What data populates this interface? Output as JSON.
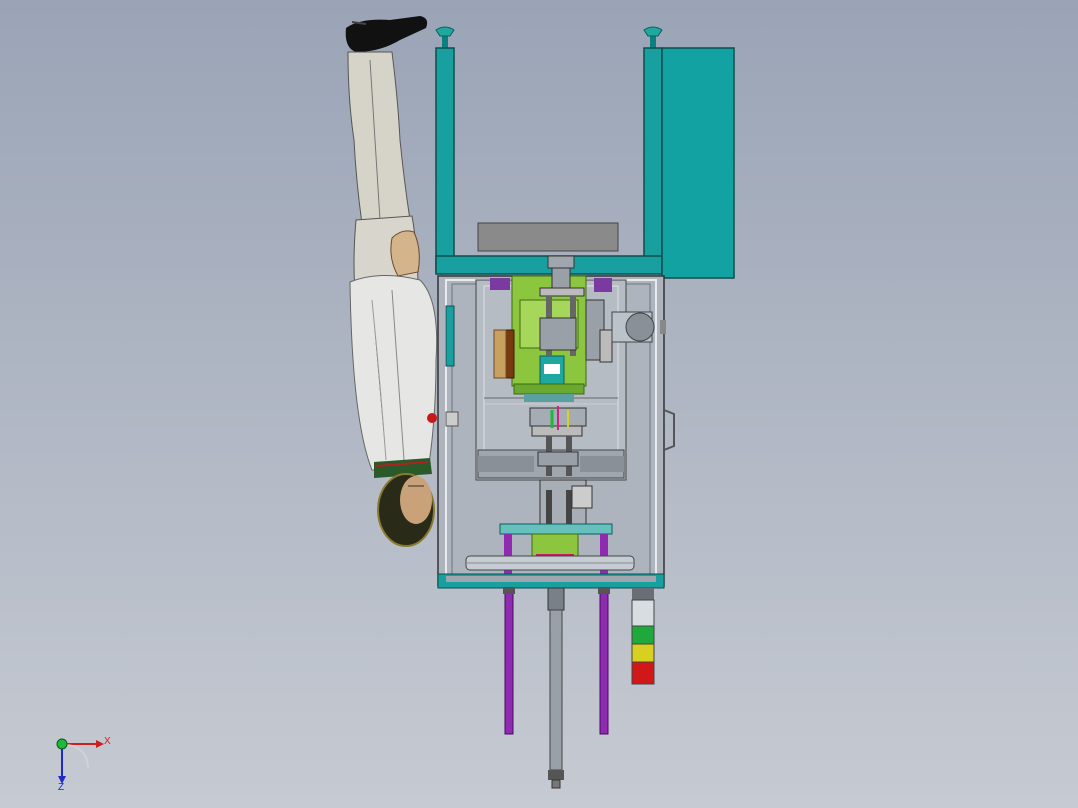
{
  "viewport": {
    "background_top": "#9aa4b6",
    "background_bottom": "#c6cad2"
  },
  "model": {
    "frame_color": "#18a0a0",
    "frame_edge": "#0b5e5e",
    "panel_color": "#12a2a2",
    "fixture_color": "#8cc63f",
    "rod_color": "#8e2bb0",
    "sheet_metal": "#b8bcc4"
  },
  "stack_light": {
    "colors": [
      "#d8dde2",
      "#1fa83c",
      "#d8d020",
      "#d01818"
    ]
  },
  "axis_triad": {
    "x_label": "X",
    "z_label": "Z",
    "x_color": "#d01e1e",
    "y_color": "#1eb83a",
    "z_color": "#1e2ad0"
  }
}
